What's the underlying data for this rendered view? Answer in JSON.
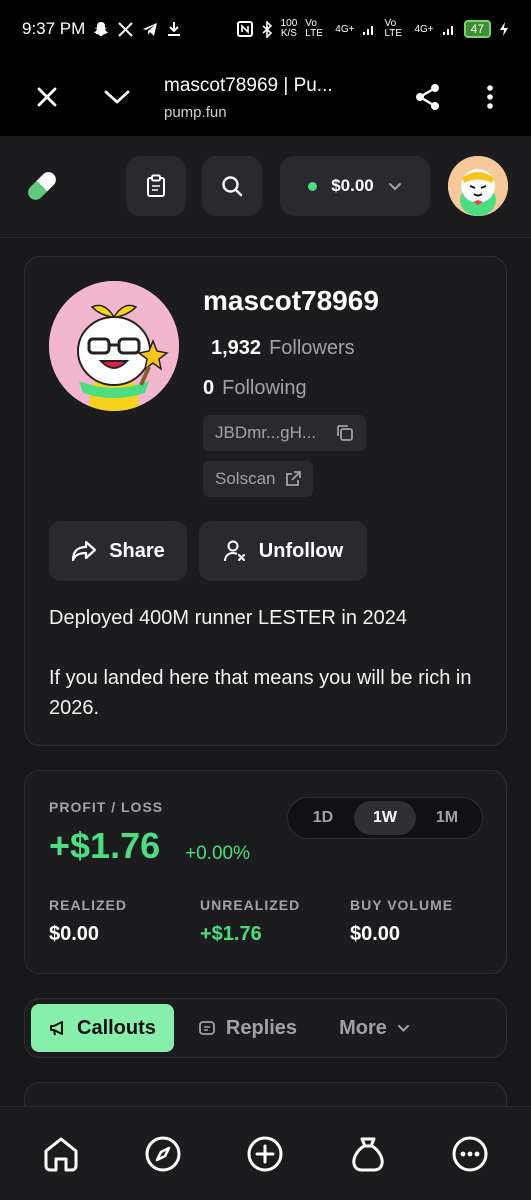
{
  "status_bar": {
    "time": "9:37 PM",
    "speed": "100",
    "speed_unit": "K/S",
    "net1": "Vo LTE",
    "net1_gen": "4G+",
    "net2": "Vo LTE",
    "net2_gen": "4G+",
    "battery": "47"
  },
  "browser": {
    "title": "mascot78969 | Pu...",
    "url": "pump.fun"
  },
  "header": {
    "balance": "$0.00"
  },
  "profile": {
    "username": "mascot78969",
    "followers_count": "1,932",
    "followers_label": "Followers",
    "following_count": "0",
    "following_label": "Following",
    "address": "JBDmr...gH...",
    "solscan_label": "Solscan",
    "share_label": "Share",
    "unfollow_label": "Unfollow",
    "bio_line1": "Deployed 400M runner LESTER in 2024",
    "bio_line2": "If you landed here that means you will be rich in 2026."
  },
  "pnl": {
    "label": "PROFIT / LOSS",
    "value": "+$1.76",
    "percent": "+0.00%",
    "ranges": [
      "1D",
      "1W",
      "1M"
    ],
    "selected_range": "1W",
    "realized_label": "REALIZED",
    "realized_value": "$0.00",
    "unrealized_label": "UNREALIZED",
    "unrealized_value": "+$1.76",
    "buy_volume_label": "BUY VOLUME",
    "buy_volume_value": "$0.00"
  },
  "tabs": {
    "callouts": "Callouts",
    "replies": "Replies",
    "more": "More"
  },
  "colors": {
    "accent_green": "#4ade80",
    "tab_active": "#86efac",
    "background": "#18181b",
    "card": "#1c1c1f"
  }
}
